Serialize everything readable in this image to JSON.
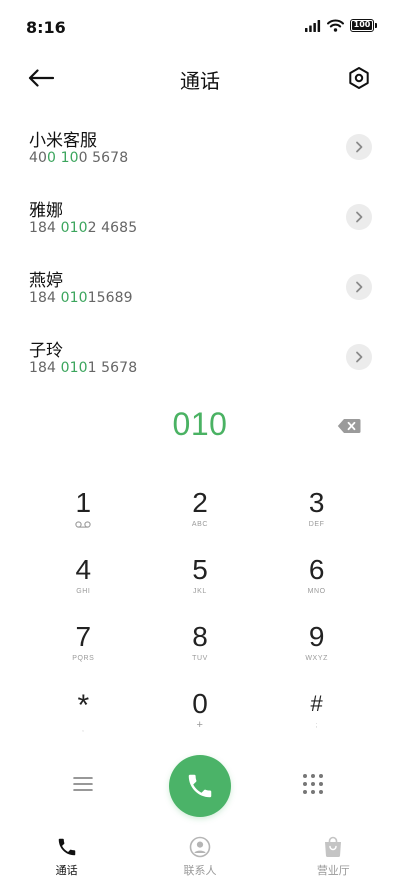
{
  "status_bar": {
    "time": "8:16",
    "battery": "100"
  },
  "header": {
    "title": "通话"
  },
  "contacts": [
    {
      "name": "小米客服",
      "number_parts": [
        {
          "t": "40",
          "h": false
        },
        {
          "t": "0",
          "h": true
        },
        {
          "t": " ",
          "h": false
        },
        {
          "t": "10",
          "h": true
        },
        {
          "t": "0 5678",
          "h": false
        }
      ]
    },
    {
      "name": "雅娜",
      "number_parts": [
        {
          "t": "184 ",
          "h": false
        },
        {
          "t": "010",
          "h": true
        },
        {
          "t": "2 4685",
          "h": false
        }
      ]
    },
    {
      "name": "燕婷",
      "number_parts": [
        {
          "t": "184 ",
          "h": false
        },
        {
          "t": "010",
          "h": true
        },
        {
          "t": "15689",
          "h": false
        }
      ]
    },
    {
      "name": "子玲",
      "number_parts": [
        {
          "t": "184 ",
          "h": false
        },
        {
          "t": "010",
          "h": true
        },
        {
          "t": "1 5678",
          "h": false
        }
      ]
    }
  ],
  "dial": {
    "number": "010"
  },
  "keypad": [
    {
      "digit": "1",
      "sub": "",
      "sub_icon": "voicemail-icon"
    },
    {
      "digit": "2",
      "sub": "ABC"
    },
    {
      "digit": "3",
      "sub": "DEF"
    },
    {
      "digit": "4",
      "sub": "GHI"
    },
    {
      "digit": "5",
      "sub": "JKL"
    },
    {
      "digit": "6",
      "sub": "MNO"
    },
    {
      "digit": "7",
      "sub": "PQRS"
    },
    {
      "digit": "8",
      "sub": "TUV"
    },
    {
      "digit": "9",
      "sub": "WXYZ"
    },
    {
      "digit": "*",
      "sub": ","
    },
    {
      "digit": "0",
      "sub": "+"
    },
    {
      "digit": "#",
      "sub": ";"
    }
  ],
  "tabs": [
    {
      "label": "通话",
      "icon": "phone-icon",
      "active": true
    },
    {
      "label": "联系人",
      "icon": "contact-icon",
      "active": false
    },
    {
      "label": "营业厅",
      "icon": "shopping-bag-icon",
      "active": false
    }
  ],
  "colors": {
    "accent": "#4ab263",
    "call_button": "#4bb368",
    "text": "#111111",
    "muted": "#999999"
  }
}
